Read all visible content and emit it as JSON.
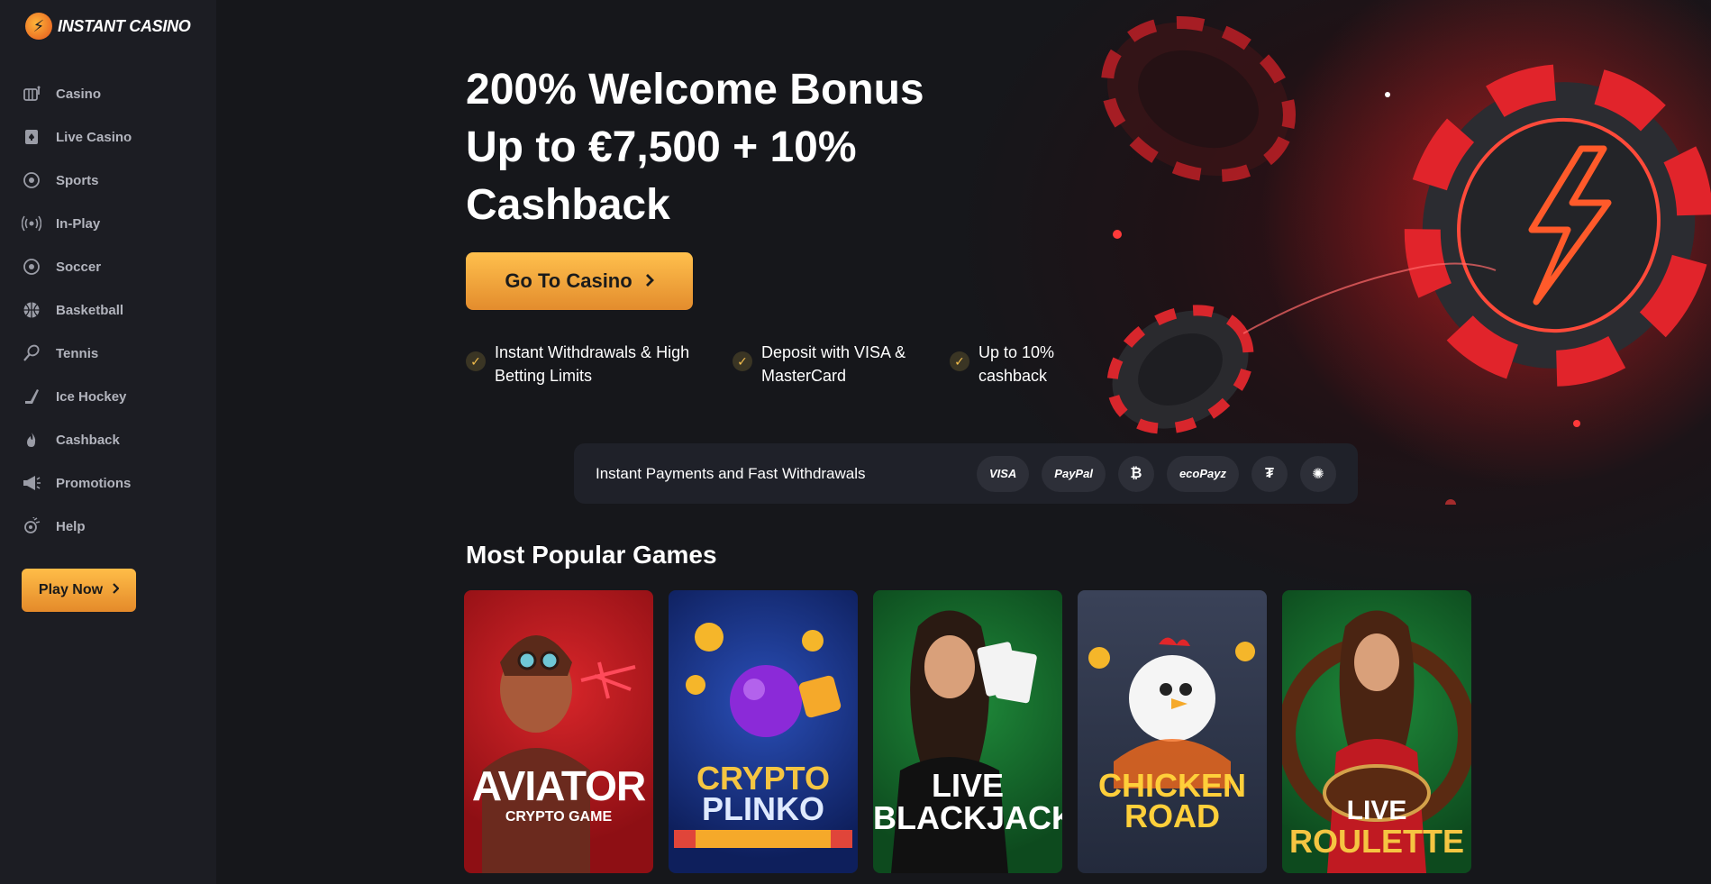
{
  "brand": {
    "name": "INSTANT CASINO"
  },
  "sidebar": {
    "items": [
      {
        "label": "Casino",
        "icon": "slot-machine-icon"
      },
      {
        "label": "Live Casino",
        "icon": "card-spade-icon"
      },
      {
        "label": "Sports",
        "icon": "ball-icon"
      },
      {
        "label": "In-Play",
        "icon": "broadcast-icon"
      },
      {
        "label": "Soccer",
        "icon": "soccer-icon"
      },
      {
        "label": "Basketball",
        "icon": "basketball-icon"
      },
      {
        "label": "Tennis",
        "icon": "tennis-icon"
      },
      {
        "label": "Ice Hockey",
        "icon": "hockey-stick-icon"
      },
      {
        "label": "Cashback",
        "icon": "flame-icon"
      },
      {
        "label": "Promotions",
        "icon": "megaphone-icon"
      },
      {
        "label": "Help",
        "icon": "support-icon"
      }
    ],
    "cta_label": "Play Now"
  },
  "hero": {
    "headline": "200% Welcome Bonus Up to €7,500 + 10% Cashback",
    "cta_label": "Go To Casino",
    "features": [
      {
        "text": "Instant Withdrawals & High Betting Limits"
      },
      {
        "text": "Deposit with VISA & MasterCard"
      },
      {
        "text": "Up to 10% cashback"
      }
    ]
  },
  "payments": {
    "label": "Instant Payments and Fast Withdrawals",
    "methods": [
      "VISA",
      "PayPal",
      "₿",
      "ecoPayz",
      "₮",
      "✺"
    ]
  },
  "games_section": {
    "title": "Most Popular Games",
    "games": [
      {
        "title": "AVIATOR",
        "subtitle": "CRYPTO GAME"
      },
      {
        "title": "CRYPTO",
        "subtitle": "PLINKO"
      },
      {
        "title": "LIVE",
        "subtitle": "BLACKJACK"
      },
      {
        "title": "CHICKEN",
        "subtitle": "ROAD"
      },
      {
        "title": "LIVE",
        "subtitle": "ROULETTE"
      }
    ]
  },
  "colors": {
    "accent": "#f5a93a",
    "sidebar_bg": "#1c1d23",
    "page_bg": "#131418"
  }
}
